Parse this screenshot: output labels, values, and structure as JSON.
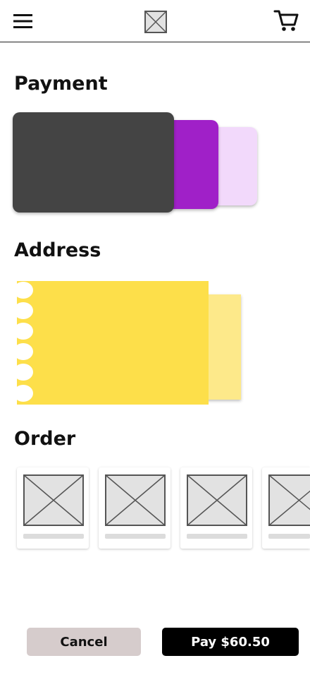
{
  "header": {
    "menu_icon": "hamburger-menu-icon",
    "logo_icon": "image-placeholder-icon",
    "cart_icon": "shopping-cart-icon"
  },
  "sections": {
    "payment": "Payment",
    "address": "Address",
    "order": "Order"
  },
  "payment_cards": [
    {
      "color": "#444444"
    },
    {
      "color": "#a020c8"
    },
    {
      "color": "#f2d9fb"
    }
  ],
  "address_cards": [
    {
      "color": "#fddf4a"
    },
    {
      "color": "#fde98a"
    }
  ],
  "order_items": [
    {
      "icon": "image-placeholder-icon"
    },
    {
      "icon": "image-placeholder-icon"
    },
    {
      "icon": "image-placeholder-icon"
    },
    {
      "icon": "image-placeholder-icon"
    }
  ],
  "actions": {
    "cancel_label": "Cancel",
    "pay_label": "Pay $60.50"
  }
}
